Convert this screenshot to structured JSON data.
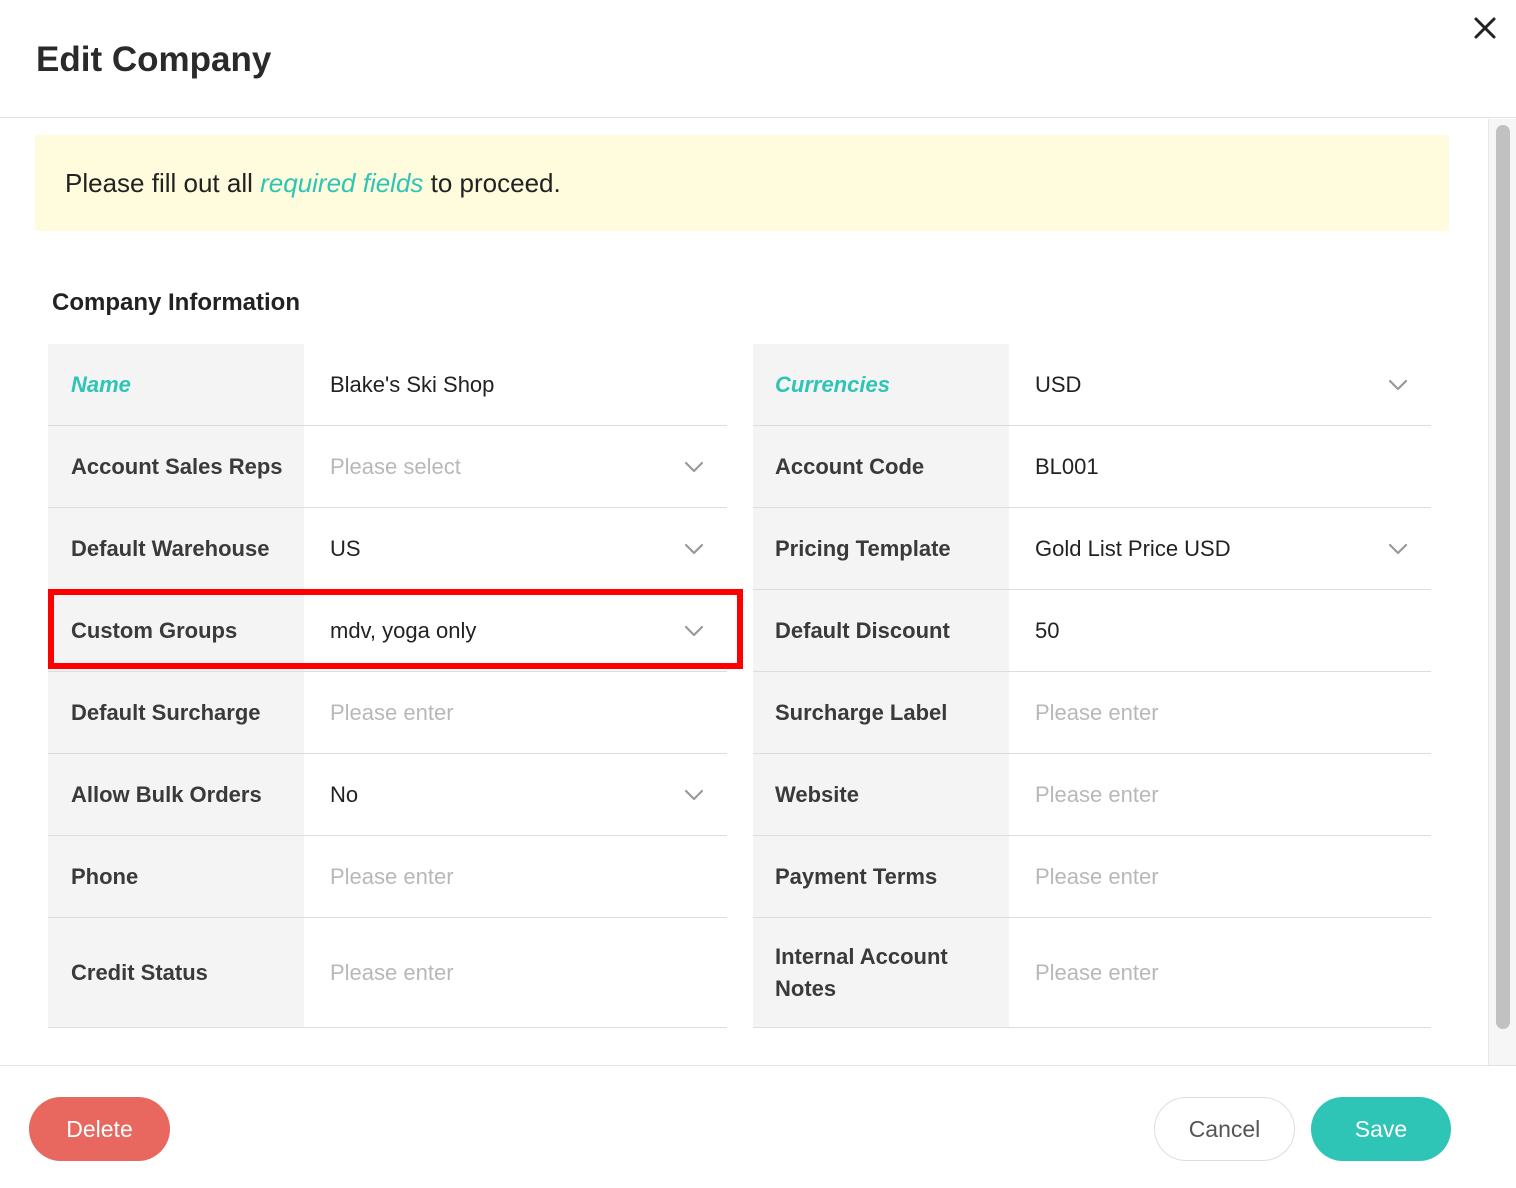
{
  "modal": {
    "title": "Edit Company"
  },
  "notice": {
    "prefix": "Please fill out all ",
    "link": "required fields",
    "suffix": " to proceed."
  },
  "section": {
    "title": "Company Information"
  },
  "left_fields": [
    {
      "label": "Name",
      "value": "Blake's Ski Shop",
      "placeholder": "",
      "required": true,
      "dropdown": false
    },
    {
      "label": "Account Sales Reps",
      "value": "",
      "placeholder": "Please select",
      "required": false,
      "dropdown": true
    },
    {
      "label": "Default Warehouse",
      "value": "US",
      "placeholder": "",
      "required": false,
      "dropdown": true
    },
    {
      "label": "Custom Groups",
      "value": "mdv, yoga only",
      "placeholder": "",
      "required": false,
      "dropdown": true
    },
    {
      "label": "Default Surcharge",
      "value": "",
      "placeholder": "Please enter",
      "required": false,
      "dropdown": false
    },
    {
      "label": "Allow Bulk Orders",
      "value": "No",
      "placeholder": "",
      "required": false,
      "dropdown": true
    },
    {
      "label": "Phone",
      "value": "",
      "placeholder": "Please enter",
      "required": false,
      "dropdown": false
    },
    {
      "label": "Credit Status",
      "value": "",
      "placeholder": "Please enter",
      "required": false,
      "dropdown": false
    }
  ],
  "right_fields": [
    {
      "label": "Currencies",
      "value": "USD",
      "placeholder": "",
      "required": true,
      "dropdown": true
    },
    {
      "label": "Account Code",
      "value": "BL001",
      "placeholder": "",
      "required": false,
      "dropdown": false
    },
    {
      "label": "Pricing Template",
      "value": "Gold List Price USD",
      "placeholder": "",
      "required": false,
      "dropdown": true
    },
    {
      "label": "Default Discount",
      "value": "50",
      "placeholder": "",
      "required": false,
      "dropdown": false
    },
    {
      "label": "Surcharge Label",
      "value": "",
      "placeholder": "Please enter",
      "required": false,
      "dropdown": false
    },
    {
      "label": "Website",
      "value": "",
      "placeholder": "Please enter",
      "required": false,
      "dropdown": false
    },
    {
      "label": "Payment Terms",
      "value": "",
      "placeholder": "Please enter",
      "required": false,
      "dropdown": false
    },
    {
      "label": "Internal Account Notes",
      "value": "",
      "placeholder": "Please enter",
      "required": false,
      "dropdown": false
    }
  ],
  "footer": {
    "delete_label": "Delete",
    "cancel_label": "Cancel",
    "save_label": "Save"
  },
  "colors": {
    "accent": "#2ec4b6",
    "danger": "#e8675f",
    "notice_bg": "#fefcdc",
    "highlight": "#ff0000"
  },
  "icons": {
    "close": "close-icon",
    "dropdown": "chevron-down-icon"
  }
}
